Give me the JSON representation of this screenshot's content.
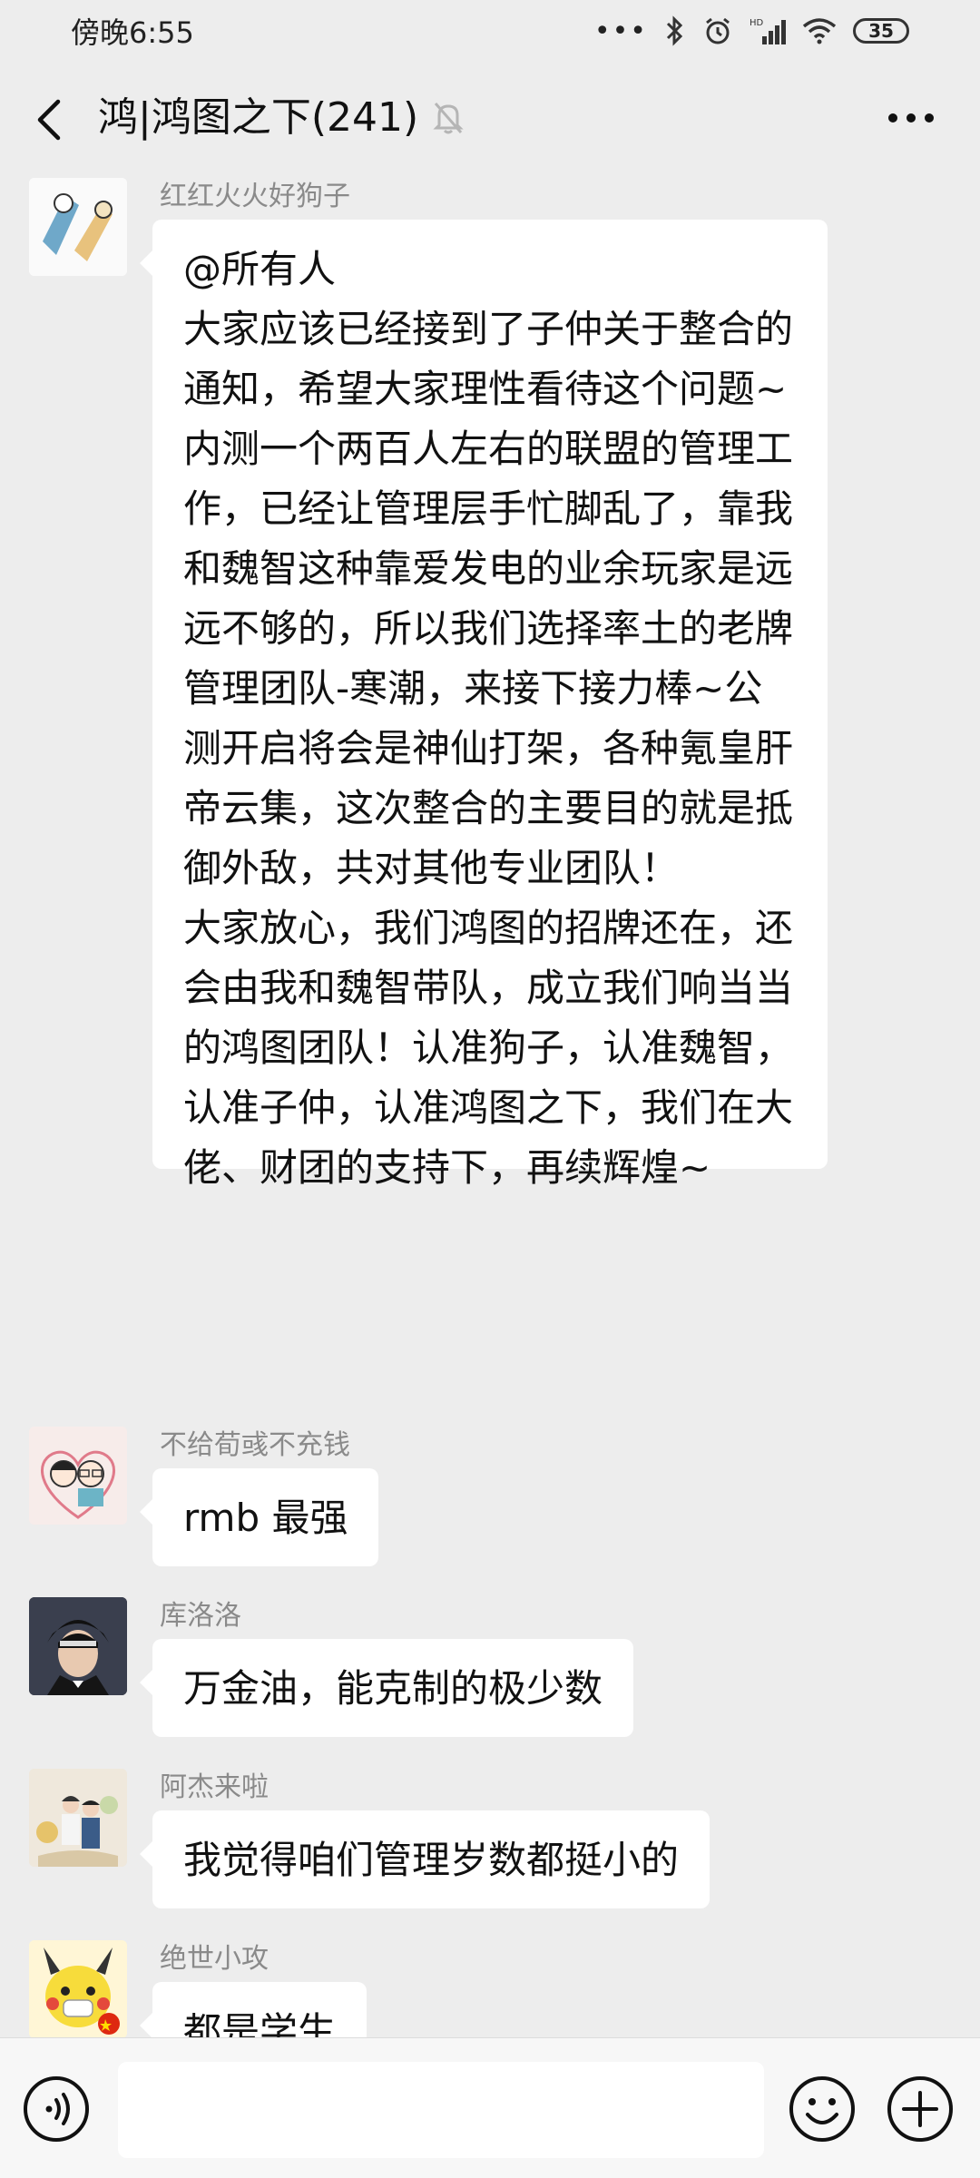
{
  "status": {
    "time": "傍晚6:55",
    "battery": "35"
  },
  "header": {
    "title": "鸿|鸿图之下(241)"
  },
  "messages": [
    {
      "sender": "红红火火好狗子",
      "text": "@所有人\n大家应该已经接到了子仲关于整合的通知，希望大家理性看待这个问题~\n内测一个两百人左右的联盟的管理工作，已经让管理层手忙脚乱了，靠我和魏智这种靠爱发电的业余玩家是远远不够的，所以我们选择率土的老牌管理团队-寒潮，来接下接力棒~公测开启将会是神仙打架，各种氪皇肝帝云集，这次整合的主要目的就是抵御外敌，共对其他专业团队！\n大家放心，我们鸿图的招牌还在，还会由我和魏智带队，成立我们响当当的鸿图团队！认准狗子，认准魏智，认准子仲，认准鸿图之下，我们在大佬、财团的支持下，再续辉煌~"
    },
    {
      "sender": "不给荀彧不充钱",
      "text": "rmb 最强"
    },
    {
      "sender": "库洛洛",
      "text": "万金油，能克制的极少数"
    },
    {
      "sender": "阿杰来啦",
      "text": "我觉得咱们管理岁数都挺小的"
    },
    {
      "sender": "绝世小攻",
      "text": "都是学生"
    }
  ]
}
